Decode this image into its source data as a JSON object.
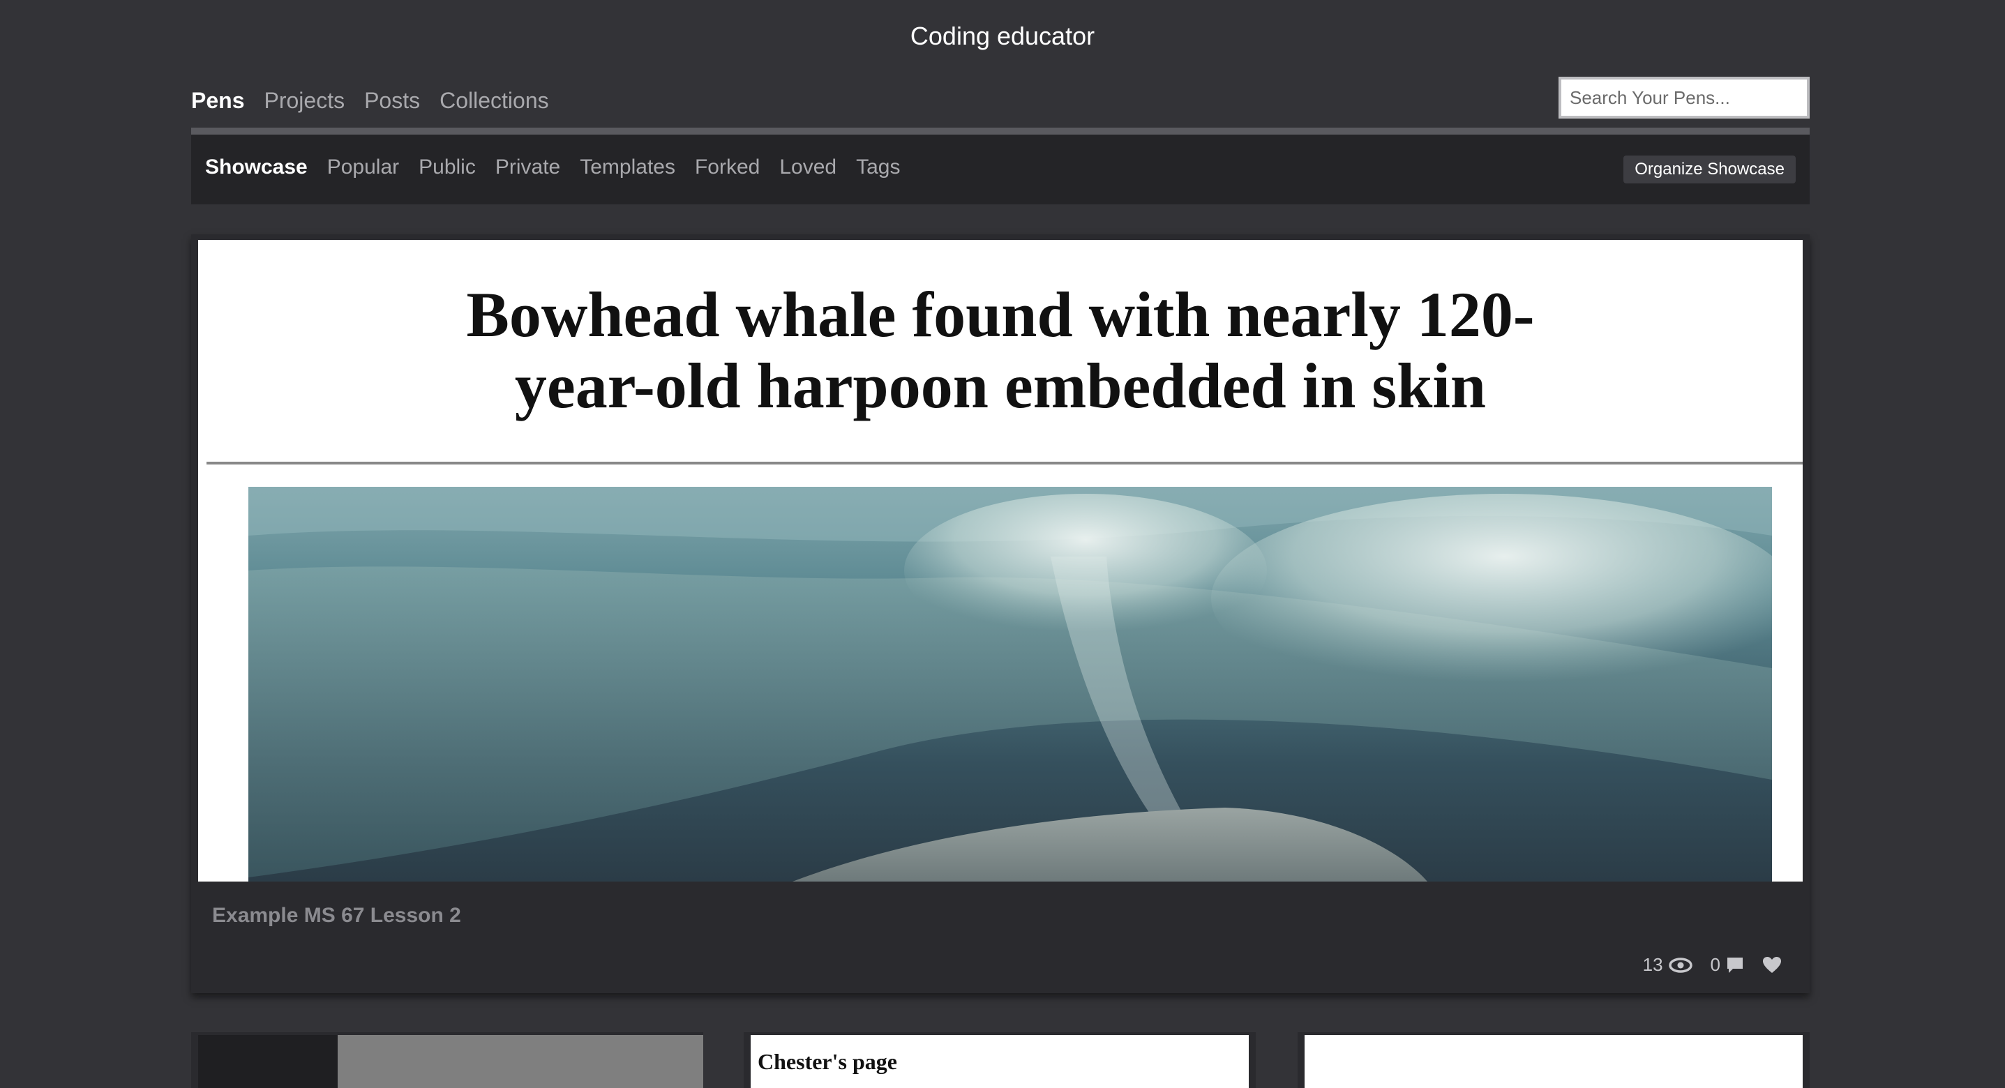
{
  "header": {
    "title": "Coding educator"
  },
  "top_tabs": [
    {
      "label": "Pens",
      "active": true
    },
    {
      "label": "Projects",
      "active": false
    },
    {
      "label": "Posts",
      "active": false
    },
    {
      "label": "Collections",
      "active": false
    }
  ],
  "search": {
    "placeholder": "Search Your Pens...",
    "value": ""
  },
  "sub_tabs": [
    {
      "label": "Showcase",
      "active": true
    },
    {
      "label": "Popular",
      "active": false
    },
    {
      "label": "Public",
      "active": false
    },
    {
      "label": "Private",
      "active": false
    },
    {
      "label": "Templates",
      "active": false
    },
    {
      "label": "Forked",
      "active": false
    },
    {
      "label": "Loved",
      "active": false
    },
    {
      "label": "Tags",
      "active": false
    }
  ],
  "organize_button": "Organize Showcase",
  "showcase": {
    "headline_line1": "Bowhead whale found with nearly 120-",
    "headline_line2": "year-old harpoon embedded in skin",
    "photo_subject": "underwater bowhead whale photo",
    "title": "Example MS 67 Lesson 2",
    "views": "13",
    "comments": "0",
    "icons": [
      "eye-icon",
      "comment-icon",
      "heart-icon"
    ]
  },
  "grid_cards": [
    {
      "title": ""
    },
    {
      "title": "Chester's page"
    },
    {
      "title": ""
    }
  ],
  "colors": {
    "background": "#333337",
    "subnav": "#242427",
    "card": "#2a2a2e",
    "active_text": "#ffffff",
    "inactive_text": "#a9a9ad"
  }
}
